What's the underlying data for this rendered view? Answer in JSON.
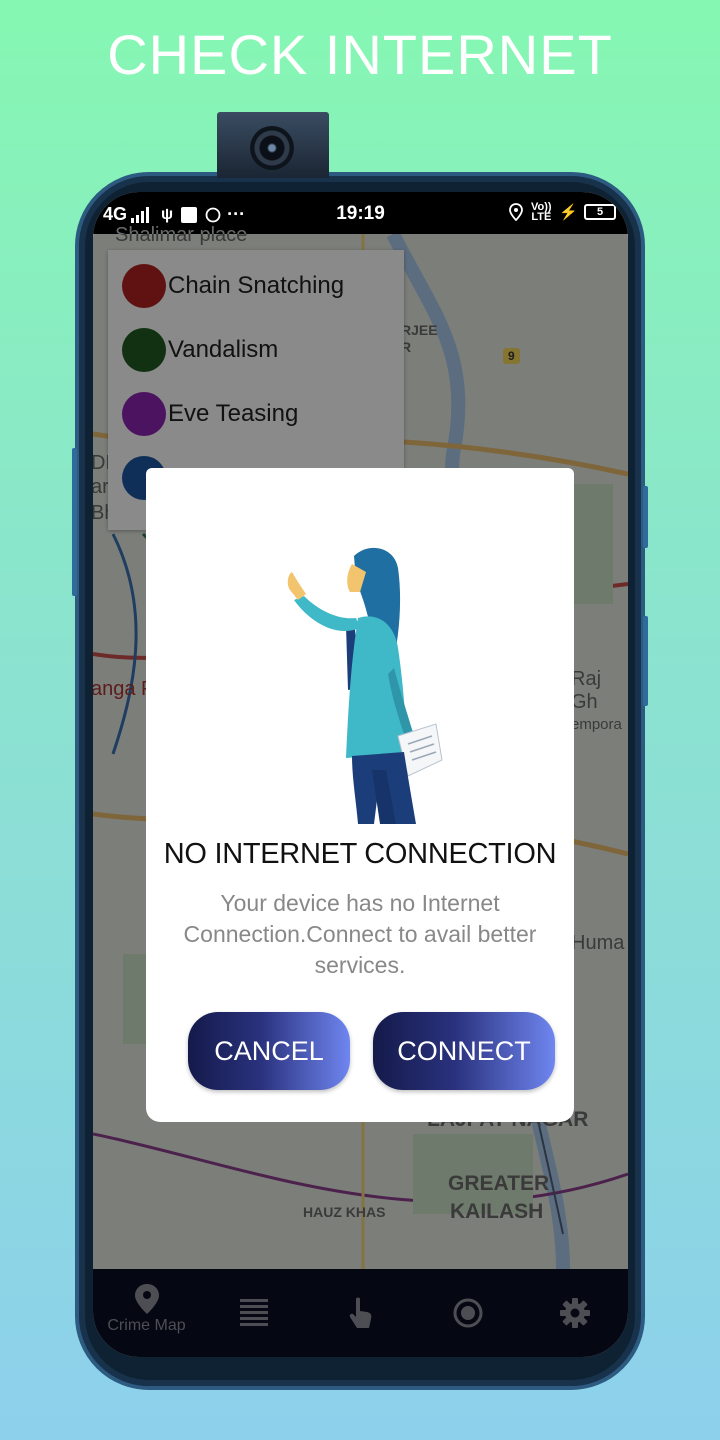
{
  "page": {
    "headline": "CHECK INTERNET"
  },
  "statusbar": {
    "network": "4G",
    "time": "19:19",
    "volte": "Vo)) LTE",
    "battery": "5"
  },
  "map": {
    "legend": [
      {
        "label": "Chain Snatching",
        "color": "#b02020"
      },
      {
        "label": "Vandalism",
        "color": "#1f5a22"
      },
      {
        "label": "Eve Teasing",
        "color": "#8a24b0"
      },
      {
        "label": "",
        "color": "#1d56a3"
      }
    ],
    "labels": {
      "shalimar": "Shalimar place",
      "rajghat": "Raj Gh",
      "tempora": "empora",
      "huma": "Huma",
      "ganga": "anga P",
      "bharat": "Bharat",
      "dd": "DD",
      "arl": "arl",
      "rjee": "RJEE",
      "r": "R",
      "road_no": "9",
      "lajpat": "LAJPAT NAGAR",
      "greater": "GREATER",
      "kailash": "KAILASH",
      "hauz": "HAUZ KHAS"
    }
  },
  "dialog": {
    "title": "NO INTERNET CONNECTION",
    "message": "Your device has no Internet Connection.Connect to avail better services.",
    "cancel_label": "CANCEL",
    "connect_label": "CONNECT"
  },
  "bottomnav": {
    "items": [
      {
        "icon": "location-pin-icon",
        "label": "Crime Map"
      },
      {
        "icon": "list-icon",
        "label": ""
      },
      {
        "icon": "tap-hand-icon",
        "label": ""
      },
      {
        "icon": "record-icon",
        "label": ""
      },
      {
        "icon": "gear-icon",
        "label": ""
      }
    ]
  }
}
